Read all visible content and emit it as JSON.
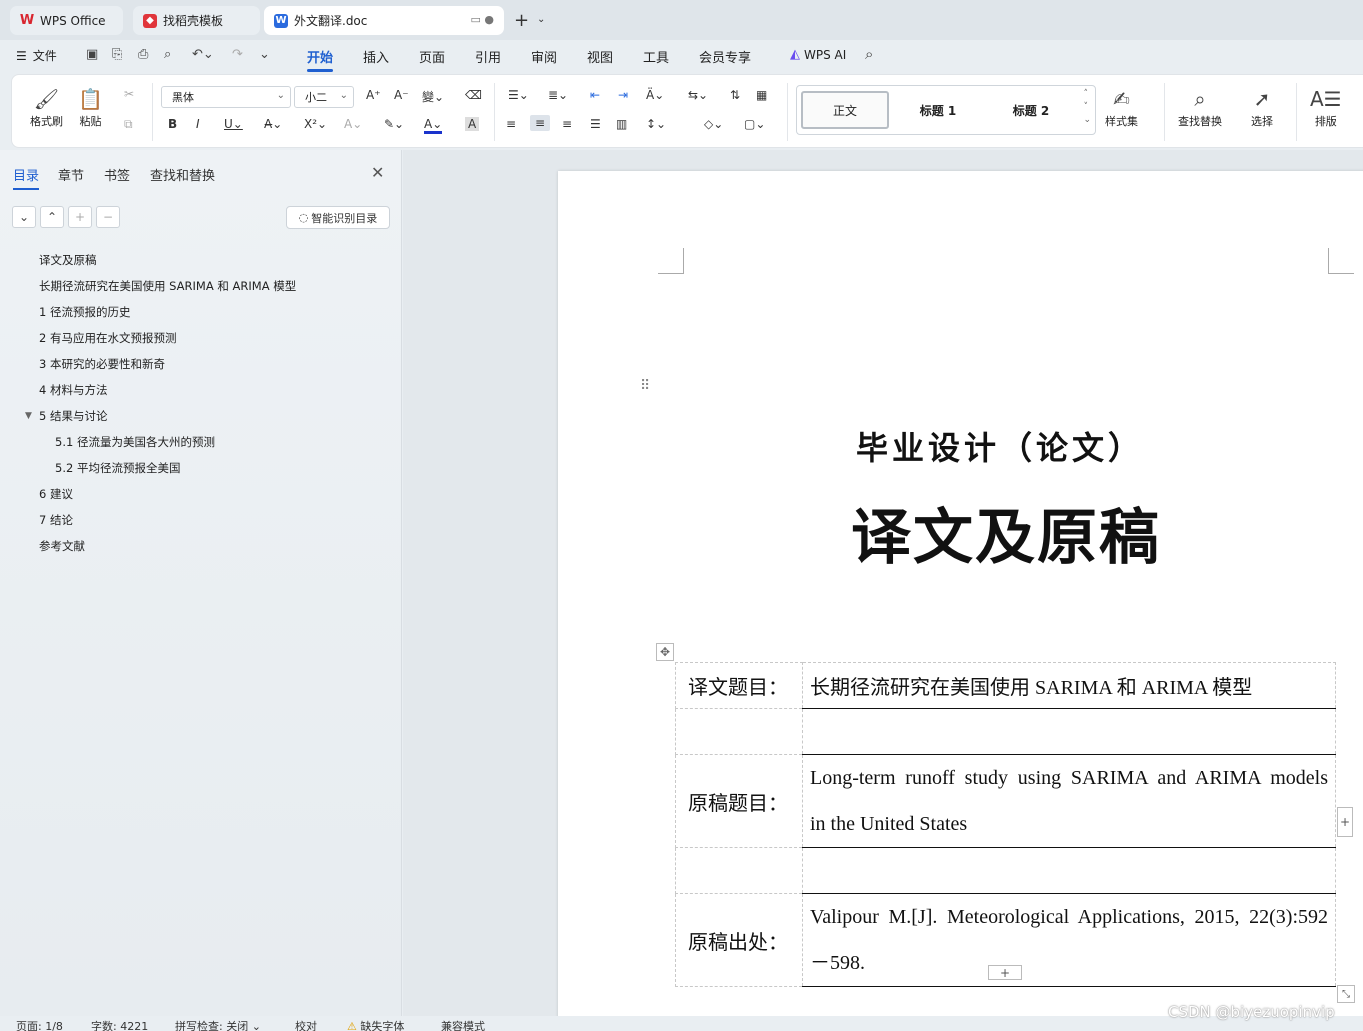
{
  "tabs": [
    {
      "label": "WPS Office",
      "icon": "wps-logo-icon"
    },
    {
      "label": "找稻壳模板",
      "icon": "docer-icon"
    },
    {
      "label": "外文翻译.doc",
      "icon": "word-doc-icon"
    }
  ],
  "menu": {
    "file": "文件",
    "tabs": [
      "开始",
      "插入",
      "页面",
      "引用",
      "审阅",
      "视图",
      "工具",
      "会员专享"
    ],
    "ai": "WPS AI"
  },
  "ribbon": {
    "format_painter": "格式刷",
    "paste": "粘贴",
    "font_name": "黑体",
    "font_size": "小二",
    "styles": [
      "正文",
      "标题 1",
      "标题 2"
    ],
    "style_set": "样式集",
    "find_replace": "查找替换",
    "select": "选择",
    "layout": "排版"
  },
  "sidebar": {
    "tabs": [
      "目录",
      "章节",
      "书签",
      "查找和替换"
    ],
    "smart_toc": "智能识别目录",
    "toc": [
      {
        "text": "译文及原稿",
        "level": 1
      },
      {
        "text": "长期径流研究在美国使用 SARIMA 和 ARIMA 模型",
        "level": 1
      },
      {
        "text": "1  径流预报的历史",
        "level": 1
      },
      {
        "text": "2  有马应用在水文预报预测",
        "level": 1
      },
      {
        "text": "3  本研究的必要性和新奇",
        "level": 1
      },
      {
        "text": "4  材料与方法",
        "level": 1
      },
      {
        "text": "5  结果与讨论",
        "level": 1
      },
      {
        "text": "5.1 径流量为美国各大州的预测",
        "level": 2
      },
      {
        "text": "5.2 平均径流预报全美国",
        "level": 2
      },
      {
        "text": "6 建议",
        "level": 1
      },
      {
        "text": "7 结论",
        "level": 1
      },
      {
        "text": "参考文献",
        "level": 1
      }
    ]
  },
  "document": {
    "subtitle": "毕业设计（论文）",
    "title": "译文及原稿",
    "table": {
      "rows": [
        {
          "label": "译文题目：",
          "value": "长期径流研究在美国使用 SARIMA 和 ARIMA 模型"
        },
        {
          "label": "",
          "value": ""
        },
        {
          "label": "原稿题目：",
          "value_lines": [
            "Long-term runoff study using SARIMA and ARIMA models",
            "in the United States"
          ]
        },
        {
          "label": "",
          "value": ""
        },
        {
          "label": "原稿出处：",
          "value_lines": [
            "Valipour M.[J]. Meteorological Applications, 2015, 22(3):592",
            "－598."
          ]
        }
      ]
    }
  },
  "status": {
    "page": "页面: 1/8",
    "words": "字数: 4221",
    "spell": "拼写检查: 关闭",
    "proof": "校对",
    "missing_font": "缺失字体",
    "compat": "兼容模式"
  },
  "watermark": "CSDN @biyezuopinvip"
}
